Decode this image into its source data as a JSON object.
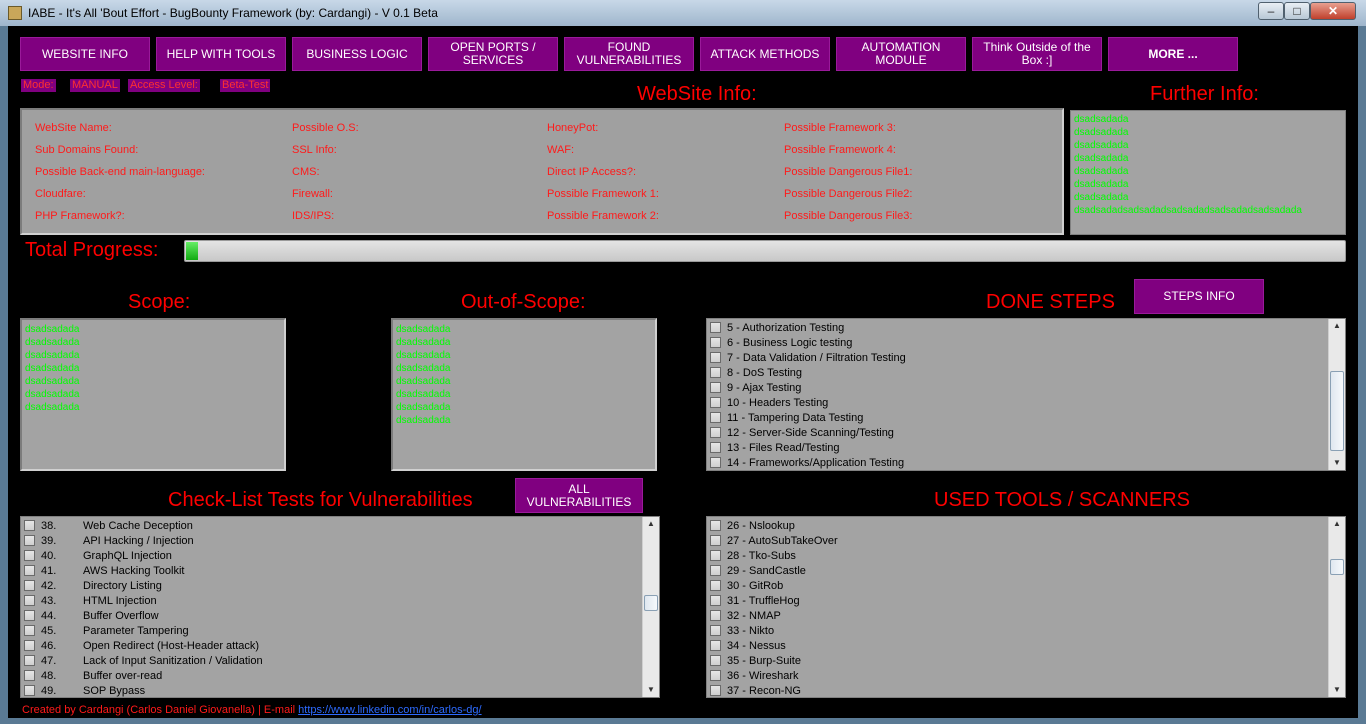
{
  "window": {
    "title": "IABE - It's All 'Bout Effort - BugBounty Framework (by: Cardangi) - V 0.1 Beta",
    "min": "–",
    "max": "□",
    "close": "✕"
  },
  "nav": [
    "WEBSITE INFO",
    "HELP WITH TOOLS",
    "BUSINESS LOGIC",
    "OPEN PORTS / SERVICES",
    "FOUND VULNERABILITIES",
    "ATTACK METHODS",
    "AUTOMATION MODULE",
    "Think Outside of the Box :]",
    "MORE ..."
  ],
  "mode": {
    "mode_label": "Mode:",
    "mode_value": "MANUAL",
    "access_label": "Access Level:",
    "access_value": "Beta-Test"
  },
  "website_info": {
    "heading": "WebSite Info:",
    "col1": [
      "WebSite Name:",
      "Sub Domains Found:",
      "Possible Back-end main-language:",
      "Cloudfare:",
      "PHP Framework?:"
    ],
    "col2": [
      "Possible O.S:",
      "SSL Info:",
      "CMS:",
      "Firewall:",
      "IDS/IPS:"
    ],
    "col3": [
      "HoneyPot:",
      "WAF:",
      "Direct IP Access?:",
      "Possible Framework 1:",
      "Possible Framework 2:"
    ],
    "col4": [
      "Possible Framework 3:",
      "Possible Framework 4:",
      "Possible Dangerous File1:",
      "Possible Dangerous File2:",
      "Possible Dangerous File3:"
    ]
  },
  "further_info": {
    "heading": "Further Info:",
    "lines": [
      "dsadsadada",
      "dsadsadada",
      "dsadsadada",
      "dsadsadada",
      "dsadsadada",
      "dsadsadada",
      "dsadsadada",
      "dsadsadadsadsadadsadsadadsadsadadsadsadada"
    ]
  },
  "progress": {
    "label": "Total Progress:",
    "value": 0.01,
    "color": "#22cc22"
  },
  "scope": {
    "heading": "Scope:",
    "lines": [
      "dsadsadada",
      "dsadsadada",
      "dsadsadada",
      "dsadsadada",
      "dsadsadada",
      "dsadsadada",
      "dsadsadada"
    ]
  },
  "out_of_scope": {
    "heading": "Out-of-Scope:",
    "lines": [
      "dsadsadada",
      "dsadsadada",
      "dsadsadada",
      "dsadsadada",
      "dsadsadada",
      "dsadsadada",
      "dsadsadada",
      "dsadsadada"
    ]
  },
  "done_steps": {
    "heading": "DONE STEPS",
    "button": "STEPS INFO",
    "items": [
      "5 - Authorization Testing",
      "6 - Business Logic testing",
      "7 - Data Validation / Filtration Testing",
      "8 - DoS Testing",
      "9 - Ajax Testing",
      "10 - Headers Testing",
      "11 - Tampering Data Testing",
      "12 - Server-Side Scanning/Testing",
      "13 - Files Read/Testing",
      "14 - Frameworks/Application Testing"
    ]
  },
  "checklist": {
    "heading": "Check-List Tests for Vulnerabilities",
    "button": "ALL VULNERABILITIES",
    "items": [
      {
        "num": "38.",
        "label": "Web Cache Deception"
      },
      {
        "num": "39.",
        "label": "API Hacking / Injection"
      },
      {
        "num": "40.",
        "label": "GraphQL Injection"
      },
      {
        "num": "41.",
        "label": "AWS Hacking Toolkit"
      },
      {
        "num": "42.",
        "label": "Directory Listing"
      },
      {
        "num": "43.",
        "label": "HTML Injection"
      },
      {
        "num": "44.",
        "label": "Buffer Overflow"
      },
      {
        "num": "45.",
        "label": "Parameter Tampering"
      },
      {
        "num": "46.",
        "label": "Open Redirect (Host-Header attack)"
      },
      {
        "num": "47.",
        "label": "Lack of Input Sanitization / Validation"
      },
      {
        "num": "48.",
        "label": "Buffer over-read"
      },
      {
        "num": "49.",
        "label": "SOP Bypass"
      }
    ]
  },
  "tools": {
    "heading": "USED TOOLS / SCANNERS",
    "items": [
      "26 - Nslookup",
      "27 - AutoSubTakeOver",
      "28 - Tko-Subs",
      "29 - SandCastle",
      "30 - GitRob",
      "31 - TruffleHog",
      "32 - NMAP",
      "33 - Nikto",
      "34 - Nessus",
      "35 - Burp-Suite",
      "36 - Wireshark",
      "37 - Recon-NG"
    ]
  },
  "footer": {
    "credit": "Created by Cardangi (Carlos Daniel Giovanella) | E-mail",
    "link": "https://www.linkedin.com/in/carlos-dg/"
  },
  "colors": {
    "accent": "#800080",
    "heading": "#ff0000",
    "data_text": "#00ff00",
    "background": "#000000"
  }
}
